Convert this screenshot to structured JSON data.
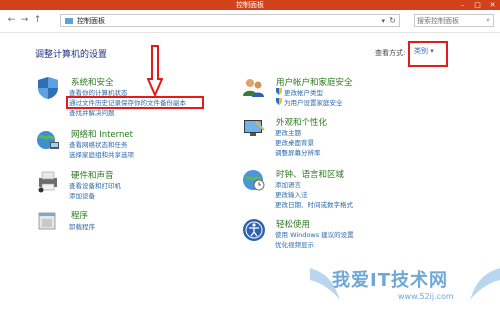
{
  "window": {
    "title": "控制面板"
  },
  "address": {
    "crumb": "控制面板",
    "search_placeholder": "搜索控制面板"
  },
  "header": {
    "heading": "调整计算机的设置",
    "view_by": "查看方式:",
    "category": "类别"
  },
  "left_items": [
    {
      "title": "系统和安全",
      "links": [
        "查看你的计算机状态",
        "通过文件历史记录保存你的文件备份副本",
        "查找并解决问题"
      ]
    },
    {
      "title": "网络和 Internet",
      "links": [
        "查看网络状态和任务",
        "选择家庭组和共享选项"
      ]
    },
    {
      "title": "硬件和声音",
      "links": [
        "查看设备和打印机",
        "添加设备"
      ]
    },
    {
      "title": "程序",
      "links": [
        "卸载程序"
      ]
    }
  ],
  "right_items": [
    {
      "title": "用户帐户和家庭安全",
      "links": [
        "更改帐户类型",
        "为用户设置家庭安全"
      ]
    },
    {
      "title": "外观和个性化",
      "links": [
        "更改主题",
        "更改桌面背景",
        "调整屏幕分辨率"
      ]
    },
    {
      "title": "时钟、语言和区域",
      "links": [
        "添加语言",
        "更改输入法",
        "更改日期、时间或数字格式"
      ]
    },
    {
      "title": "轻松使用",
      "links": [
        "使用 Windows 建议的设置",
        "优化视频显示"
      ]
    }
  ],
  "watermark": {
    "text": "我爱IT技术网",
    "url": "www.52ij.com"
  },
  "colors": {
    "titlebar": "#d1411a",
    "highlight": "#e31b1b",
    "link": "#2c6aad",
    "title": "#2b7a1f"
  },
  "icons": {
    "back": "back-arrow-icon",
    "forward": "forward-arrow-icon",
    "up": "up-arrow-icon",
    "refresh": "refresh-icon",
    "search": "search-icon"
  }
}
